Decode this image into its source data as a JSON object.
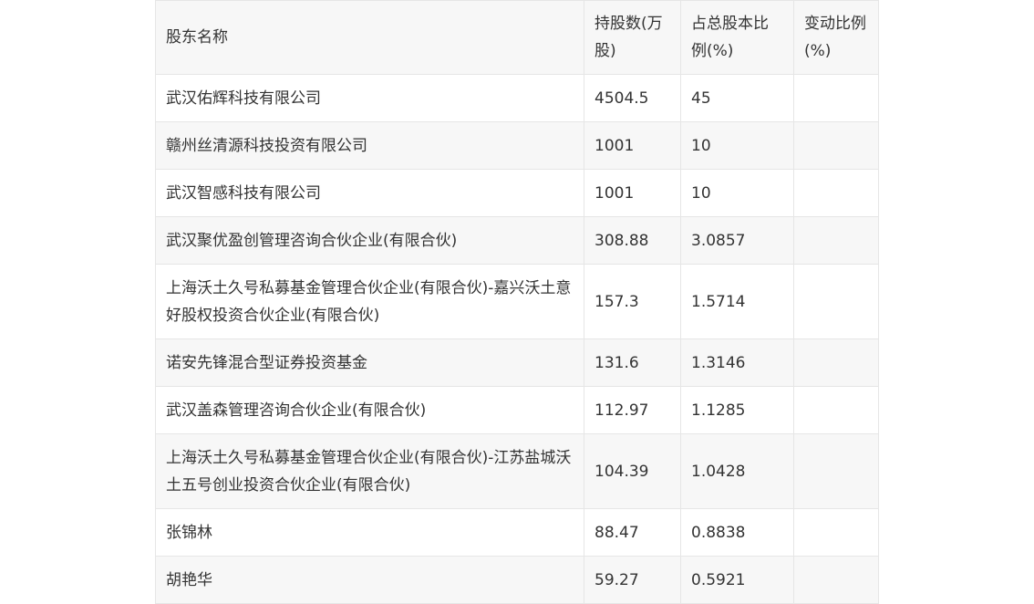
{
  "table": {
    "headers": [
      "股东名称",
      "持股数(万股)",
      "占总股本比例(%)",
      "变动比例(%)"
    ],
    "rows": [
      [
        "武汉佑辉科技有限公司",
        "4504.5",
        "45",
        ""
      ],
      [
        "赣州丝清源科技投资有限公司",
        "1001",
        "10",
        ""
      ],
      [
        "武汉智感科技有限公司",
        "1001",
        "10",
        ""
      ],
      [
        "武汉聚优盈创管理咨询合伙企业(有限合伙)",
        "308.88",
        "3.0857",
        ""
      ],
      [
        "上海沃土久号私募基金管理合伙企业(有限合伙)-嘉兴沃土意好股权投资合伙企业(有限合伙)",
        "157.3",
        "1.5714",
        ""
      ],
      [
        "诺安先锋混合型证券投资基金",
        "131.6",
        "1.3146",
        ""
      ],
      [
        "武汉盖森管理咨询合伙企业(有限合伙)",
        "112.97",
        "1.1285",
        ""
      ],
      [
        "上海沃土久号私募基金管理合伙企业(有限合伙)-江苏盐城沃土五号创业投资合伙企业(有限合伙)",
        "104.39",
        "1.0428",
        ""
      ],
      [
        "张锦林",
        "88.47",
        "0.8838",
        ""
      ],
      [
        "胡艳华",
        "59.27",
        "0.5921",
        ""
      ]
    ]
  }
}
